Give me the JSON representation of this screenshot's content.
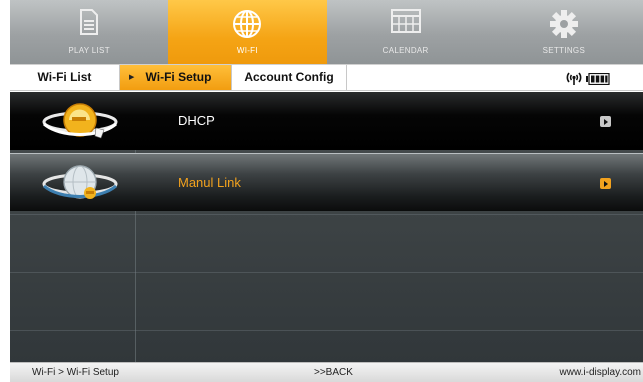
{
  "top_nav": [
    {
      "label": "PLAY LIST",
      "icon": "document-icon"
    },
    {
      "label": "WI-FI",
      "icon": "globe-icon",
      "active": true
    },
    {
      "label": "CALENDAR",
      "icon": "calendar-icon"
    },
    {
      "label": "SETTINGS",
      "icon": "gear-icon"
    }
  ],
  "sub_tabs": [
    {
      "label": "Wi-Fi List"
    },
    {
      "label": "Wi-Fi Setup",
      "active": true
    },
    {
      "label": "Account Config"
    }
  ],
  "status": {
    "wifi_icon": "wifi-signal-icon",
    "battery_icon": "battery-icon"
  },
  "list": [
    {
      "label": "DHCP",
      "icon": "internet-explorer-icon",
      "selected": false
    },
    {
      "label": "Manul Link",
      "icon": "globe-link-icon",
      "selected": true
    }
  ],
  "footer": {
    "breadcrumb": "Wi-Fi > Wi-Fi Setup",
    "back": ">>BACK",
    "site": "www.i-display.com"
  },
  "colors": {
    "accent": "#f5a415",
    "selected_text": "#f2a21e",
    "normal_text": "#ffffff",
    "play_normal": "#c8c8c8",
    "play_selected": "#f2a21e"
  }
}
